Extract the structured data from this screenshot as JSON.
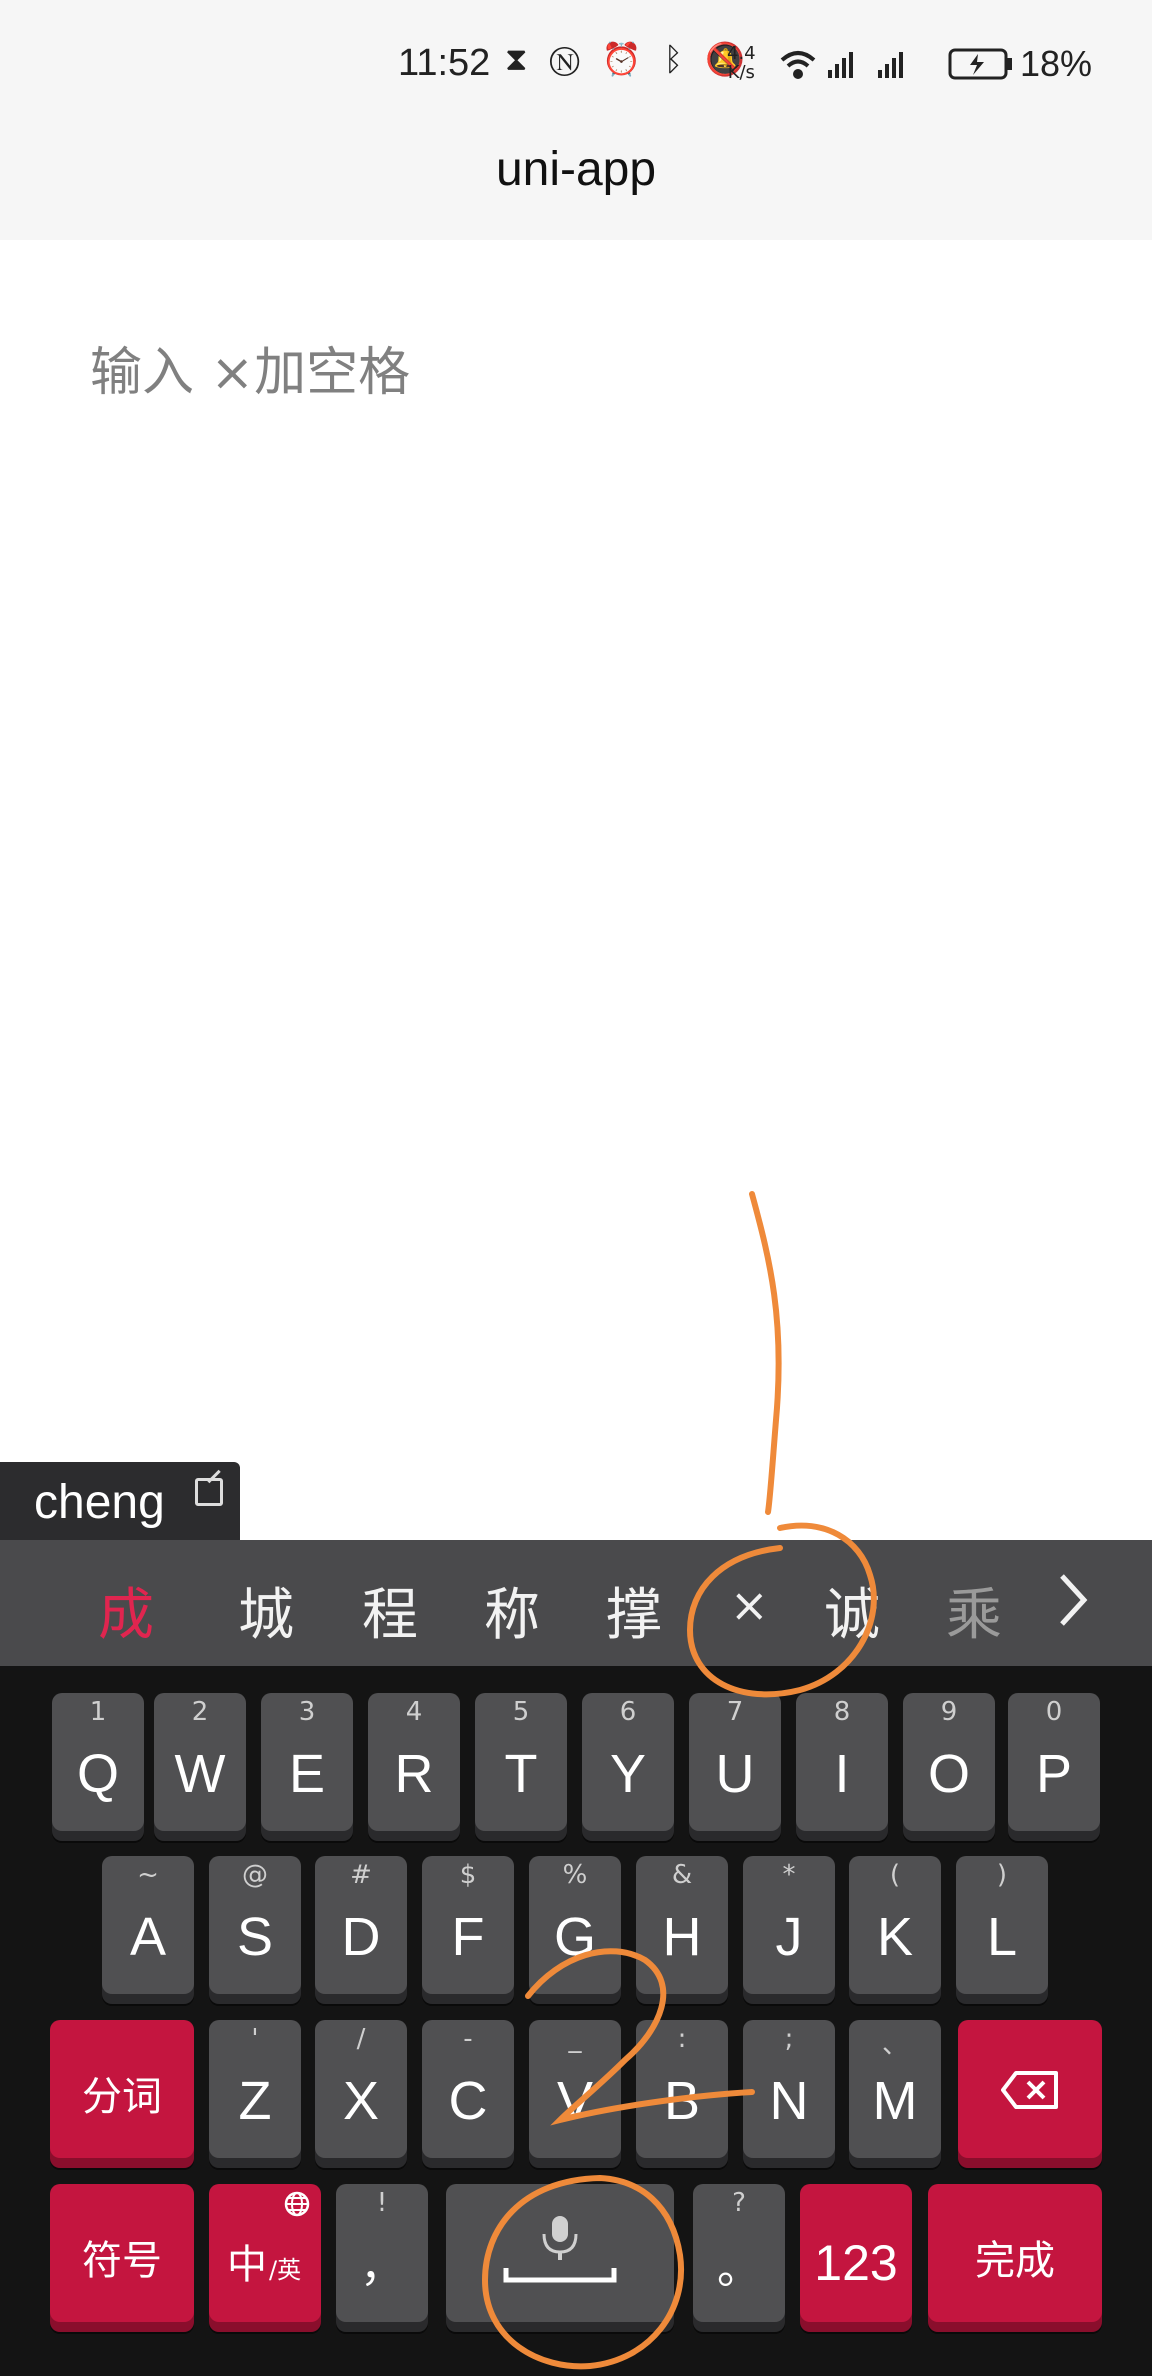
{
  "status": {
    "time": "11:52",
    "icons": [
      "hourglass-icon",
      "nfc-icon",
      "alarm-icon",
      "bluetooth-icon",
      "mute-icon"
    ],
    "net_speed_value": "4.4",
    "net_speed_unit": "K/s",
    "battery": "18%"
  },
  "app": {
    "title": "uni-app"
  },
  "input": {
    "placeholder": "输入 ×加空格"
  },
  "ime": {
    "composition": "cheng",
    "candidates": [
      "成",
      "城",
      "程",
      "称",
      "撑",
      "×",
      "诚",
      "乘"
    ],
    "more_icon": "chevron-right-icon"
  },
  "keyboard": {
    "row1": [
      {
        "letter": "Q",
        "alt": "1"
      },
      {
        "letter": "W",
        "alt": "2"
      },
      {
        "letter": "E",
        "alt": "3"
      },
      {
        "letter": "R",
        "alt": "4"
      },
      {
        "letter": "T",
        "alt": "5"
      },
      {
        "letter": "Y",
        "alt": "6"
      },
      {
        "letter": "U",
        "alt": "7"
      },
      {
        "letter": "I",
        "alt": "8"
      },
      {
        "letter": "O",
        "alt": "9"
      },
      {
        "letter": "P",
        "alt": "0"
      }
    ],
    "row2": [
      {
        "letter": "A",
        "alt": "~"
      },
      {
        "letter": "S",
        "alt": "@"
      },
      {
        "letter": "D",
        "alt": "#"
      },
      {
        "letter": "F",
        "alt": "$"
      },
      {
        "letter": "G",
        "alt": "%"
      },
      {
        "letter": "H",
        "alt": "&"
      },
      {
        "letter": "J",
        "alt": "*"
      },
      {
        "letter": "K",
        "alt": "("
      },
      {
        "letter": "L",
        "alt": ")"
      }
    ],
    "row3": [
      {
        "letter": "Z",
        "alt": "'"
      },
      {
        "letter": "X",
        "alt": "/"
      },
      {
        "letter": "C",
        "alt": "-"
      },
      {
        "letter": "V",
        "alt": "_"
      },
      {
        "letter": "B",
        "alt": ":"
      },
      {
        "letter": "N",
        "alt": ";"
      },
      {
        "letter": "M",
        "alt": "、"
      }
    ],
    "segment_label": "分词",
    "symbol_label": "符号",
    "lang_main": "中",
    "lang_sub": "/英",
    "comma": "，",
    "comma_alt": "!",
    "period": "。",
    "period_alt": "?",
    "num_label": "123",
    "done_label": "完成"
  },
  "colors": {
    "accent": "#c4153f",
    "candidate_active": "#e0254f",
    "annotation": "#ef8a3a"
  }
}
